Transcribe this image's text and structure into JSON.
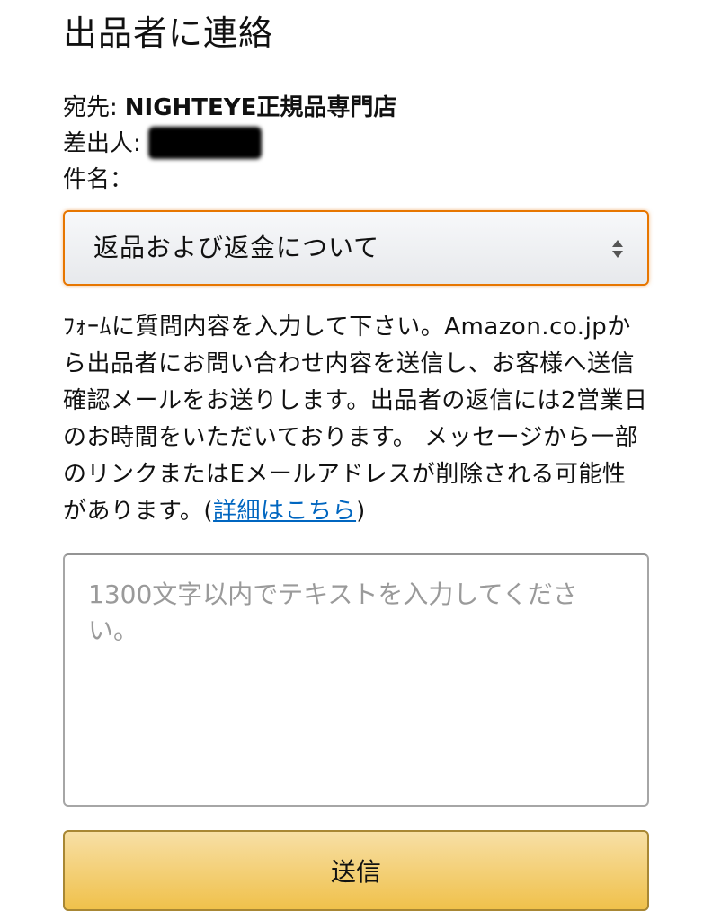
{
  "page": {
    "title": "出品者に連絡"
  },
  "meta": {
    "to_label": "宛先:",
    "to_value": "NIGHTEYE正規品専門店",
    "from_label": "差出人:",
    "subject_label": "件名："
  },
  "subject_select": {
    "selected": "返品および返金について",
    "icon": "up-down-arrows-icon"
  },
  "description": {
    "text": "ﾌｫｰﾑに質問内容を入力して下さい。Amazon.co.jpから出品者にお問い合わせ内容を送信し、お客様へ送信確認メールをお送りします。出品者の返信には2営業日のお時間をいただいております。 メッセージから一部のリンクまたはEメールアドレスが削除される可能性があります。(",
    "link_text": "詳細はこちら",
    "closing": ")"
  },
  "message_input": {
    "value": "",
    "placeholder": "1300文字以内でテキストを入力してください。"
  },
  "submit": {
    "label": "送信"
  },
  "colors": {
    "select_border": "#e77600",
    "link": "#0066c0",
    "button_top": "#f7dfa5",
    "button_bottom": "#f0c14b",
    "button_border": "#a88734"
  }
}
